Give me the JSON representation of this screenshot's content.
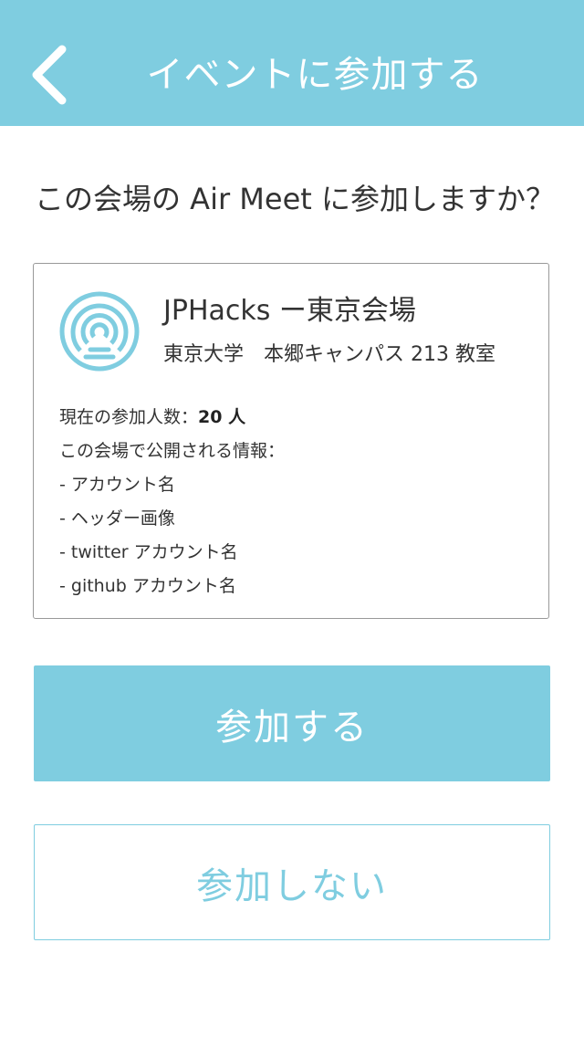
{
  "nav": {
    "title": "イベントに参加する",
    "back_icon": "chevron-left-icon"
  },
  "prompt": "この会場の Air Meet に参加しますか？",
  "venue": {
    "icon": "broadcast-icon",
    "name": "JPHacks ー東京会場",
    "location": "東京大学　本郷キャンパス 213 教室",
    "count_label": "現在の参加人数：",
    "count_value": "20 人",
    "shared_info_heading": "この会場で公開される情報：",
    "shared_info": [
      "- アカウント名",
      "- ヘッダー画像",
      "- twitter アカウント名",
      "- github アカウント名"
    ]
  },
  "actions": {
    "join_label": "参加する",
    "decline_label": "参加しない"
  },
  "colors": {
    "accent": "#7fcde0",
    "text": "#333333",
    "card_border": "#999999"
  }
}
